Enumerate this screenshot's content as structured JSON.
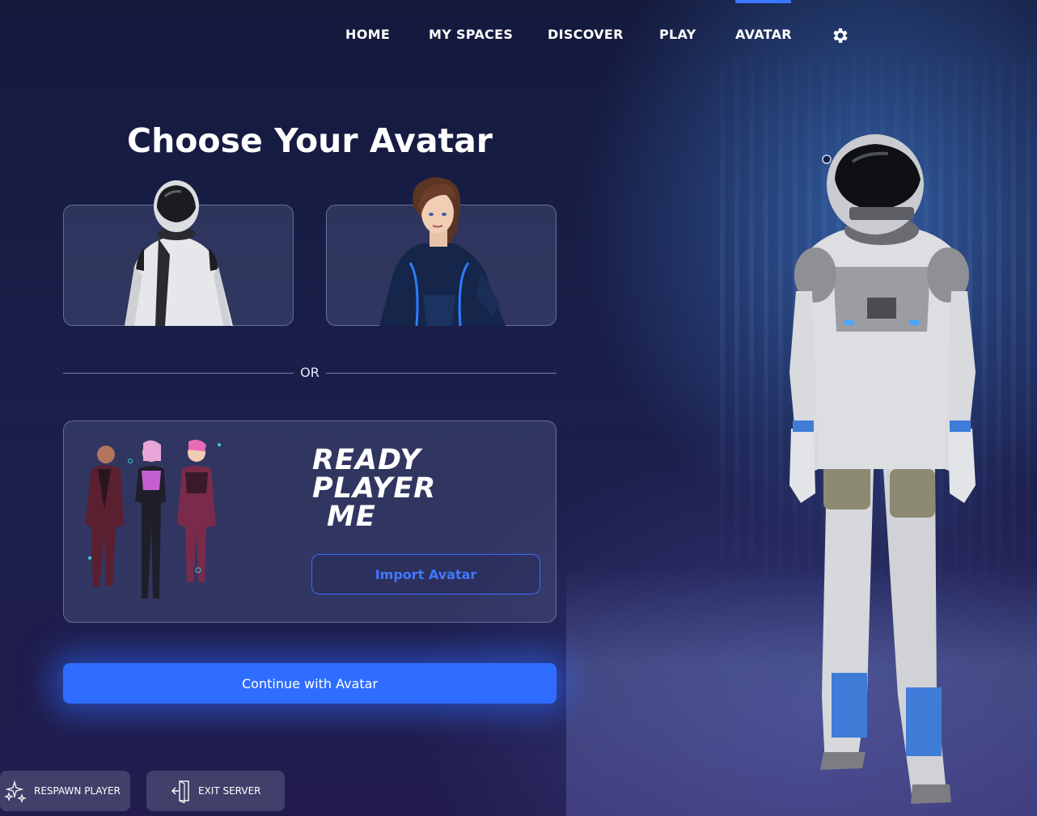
{
  "nav": {
    "items": [
      {
        "label": "HOME"
      },
      {
        "label": "MY SPACES"
      },
      {
        "label": "DISCOVER"
      },
      {
        "label": "PLAY"
      },
      {
        "label": "AVATAR"
      }
    ],
    "active": "AVATAR",
    "settings_icon": "gear-icon"
  },
  "main": {
    "title": "Choose Your Avatar",
    "avatars": [
      {
        "name": "astronaut-avatar"
      },
      {
        "name": "female-blue-suit-avatar"
      }
    ],
    "divider_text": "OR",
    "rpm": {
      "logo_lines": [
        "READY",
        "PLAYER",
        "ME"
      ],
      "import_label": "Import Avatar"
    },
    "continue_label": "Continue with Avatar"
  },
  "footer": {
    "respawn_label": "RESPAWN PLAYER",
    "exit_label": "EXIT SERVER"
  },
  "colors": {
    "accent": "#2f6dff",
    "background": "#1a1f4a"
  }
}
